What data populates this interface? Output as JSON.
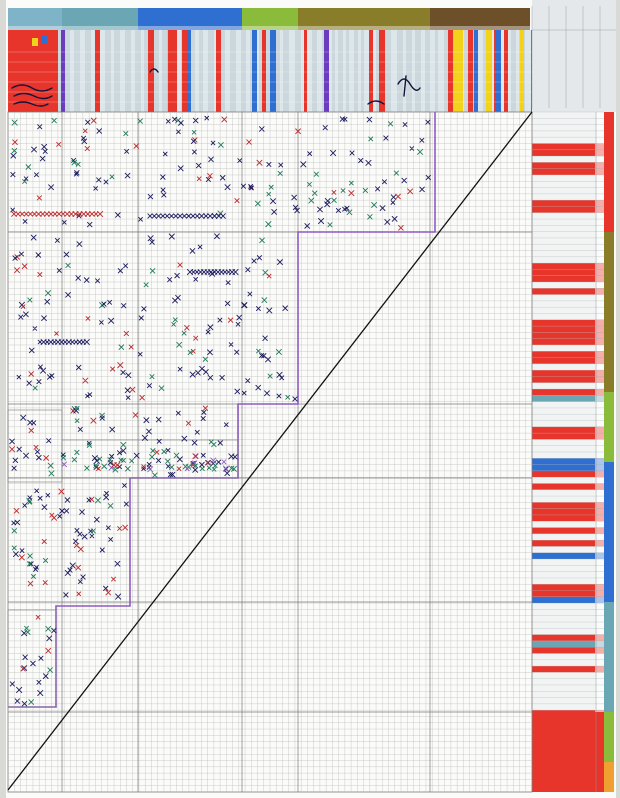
{
  "photo": {
    "subject": "",
    "background_color": "#d9d9d6",
    "paper_color": "#fbfbf9"
  },
  "chart_data": {
    "type": "table",
    "colors": {
      "grid": "#b8b8b8",
      "grid_major": "#7a7a7a",
      "purple_outline": "#8e5bc2",
      "diagonal": "#111111",
      "red": "#e8352b",
      "yellow": "#f3d21c",
      "blue": "#2f6fd1",
      "green": "#8bbb3a",
      "olive": "#8a7d2a",
      "brown": "#6d4f2a",
      "teal": "#6aa6b3",
      "orange": "#f0a030"
    }
  }
}
